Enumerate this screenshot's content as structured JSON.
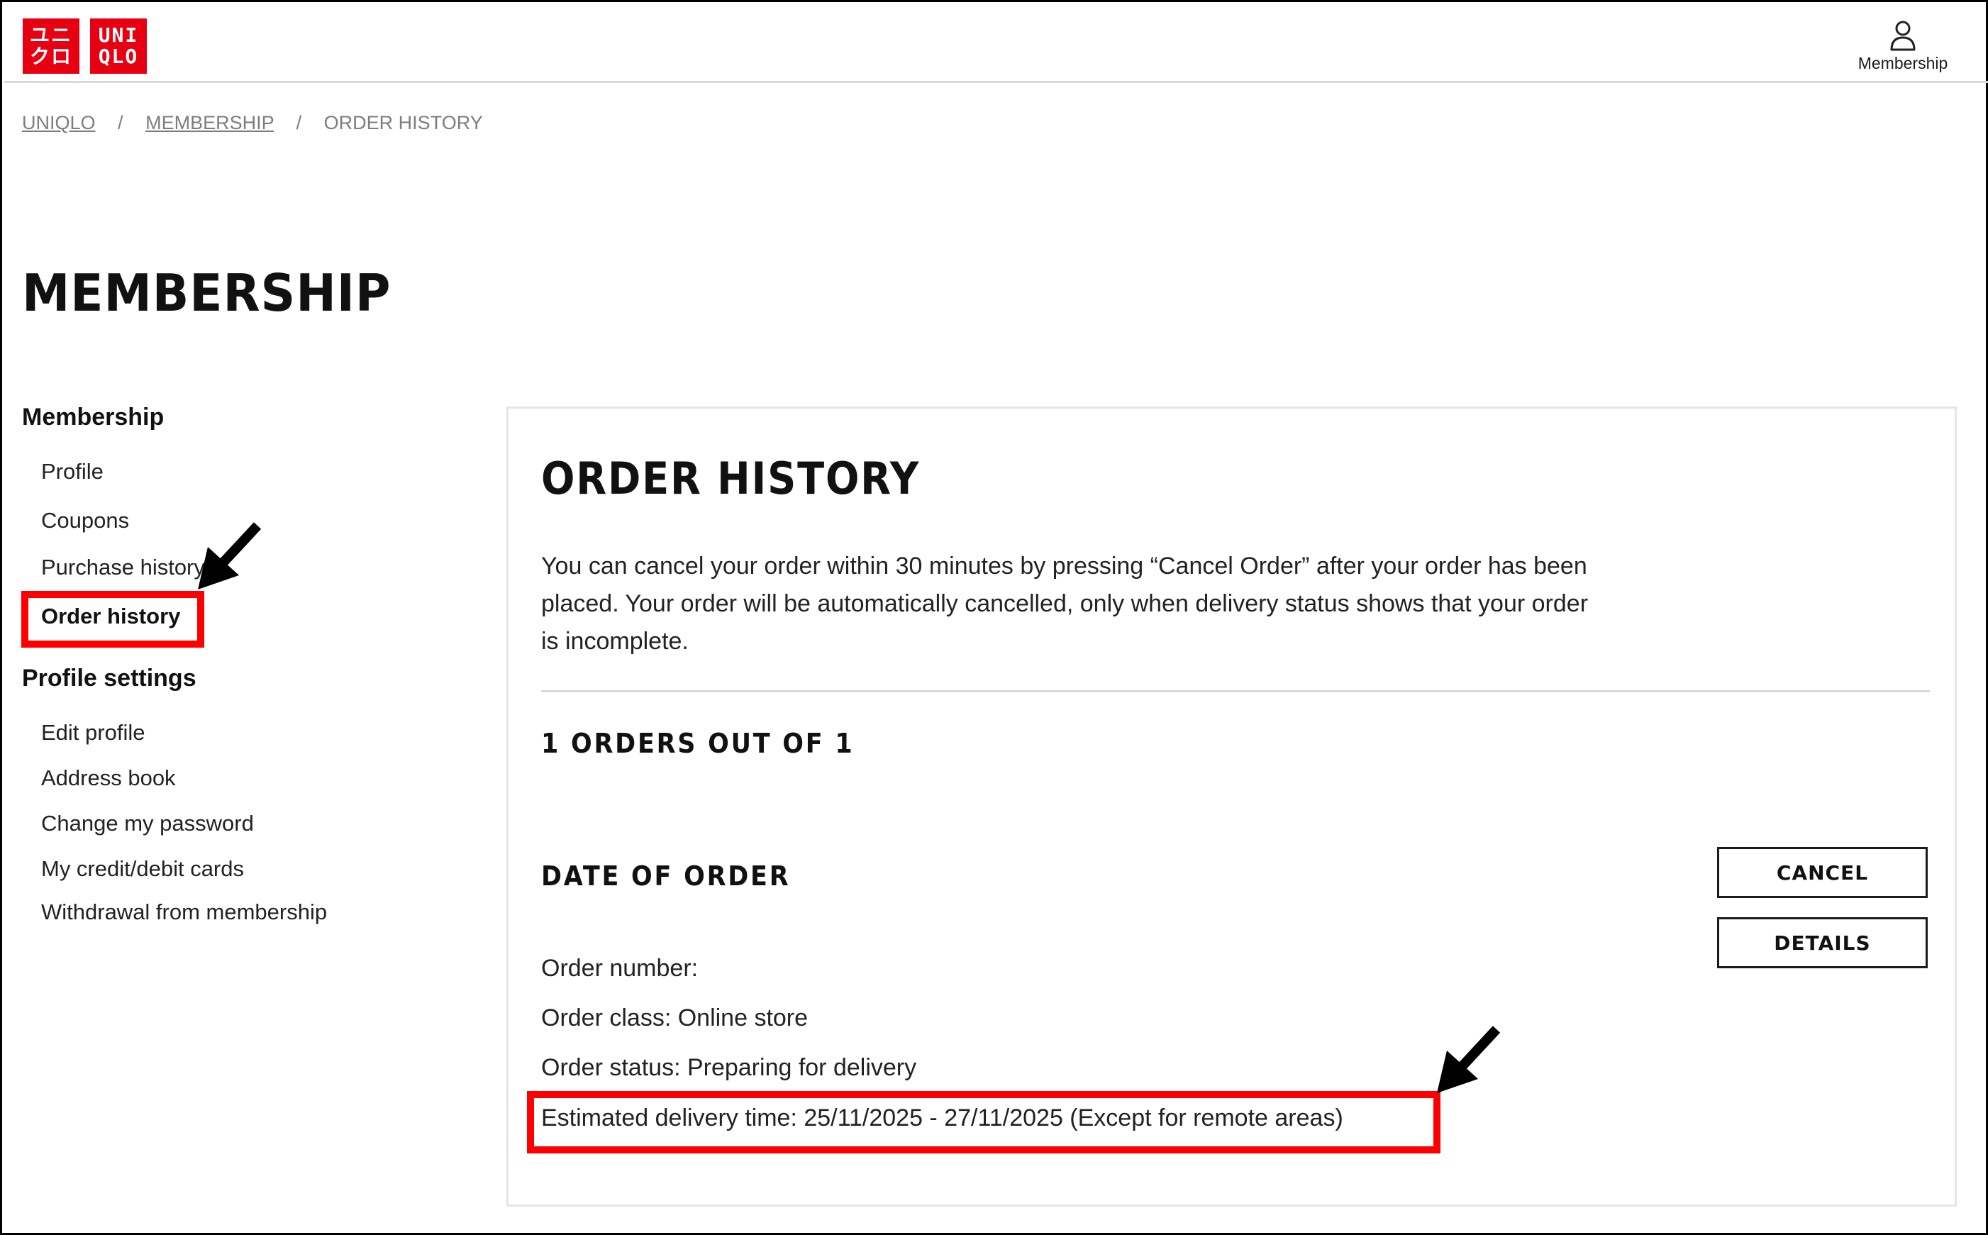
{
  "brand": {
    "logo_jp_line1": "ユニ",
    "logo_jp_line2": "クロ",
    "logo_en_line1": "UNI",
    "logo_en_line2": "QLO",
    "color": "#e60012"
  },
  "header": {
    "account_label": "Membership",
    "account_icon": "person-icon"
  },
  "breadcrumb": {
    "items": [
      "UNIQLO",
      "MEMBERSHIP",
      "ORDER HISTORY"
    ],
    "separator": "/"
  },
  "page_title": "MEMBERSHIP",
  "sidebar": {
    "membership_heading": "Membership",
    "membership_items": [
      "Profile",
      "Coupons",
      "Purchase history",
      "Order history"
    ],
    "settings_heading": "Profile settings",
    "settings_items": [
      "Edit profile",
      "Address book",
      "Change my password",
      "My credit/debit cards",
      "Withdrawal from membership"
    ],
    "active_item": "Order history"
  },
  "main": {
    "title": "ORDER HISTORY",
    "intro": "You can cancel your order within 30 minutes by pressing “Cancel Order” after your order has been placed. Your order will be automatically cancelled, only when delivery status shows that your order is incomplete.",
    "orders_count": "1 ORDERS OUT OF 1",
    "date_heading": "DATE OF ORDER",
    "order_number": "Order number:",
    "order_class": "Order class: Online store",
    "order_status": "Order status: Preparing for delivery",
    "estimated_delivery": "Estimated delivery time: 25/11/2025 - 27/11/2025 (Except for remote areas)",
    "cancel_label": "CANCEL",
    "details_label": "DETAILS"
  },
  "annotation_color": "#ff0000"
}
